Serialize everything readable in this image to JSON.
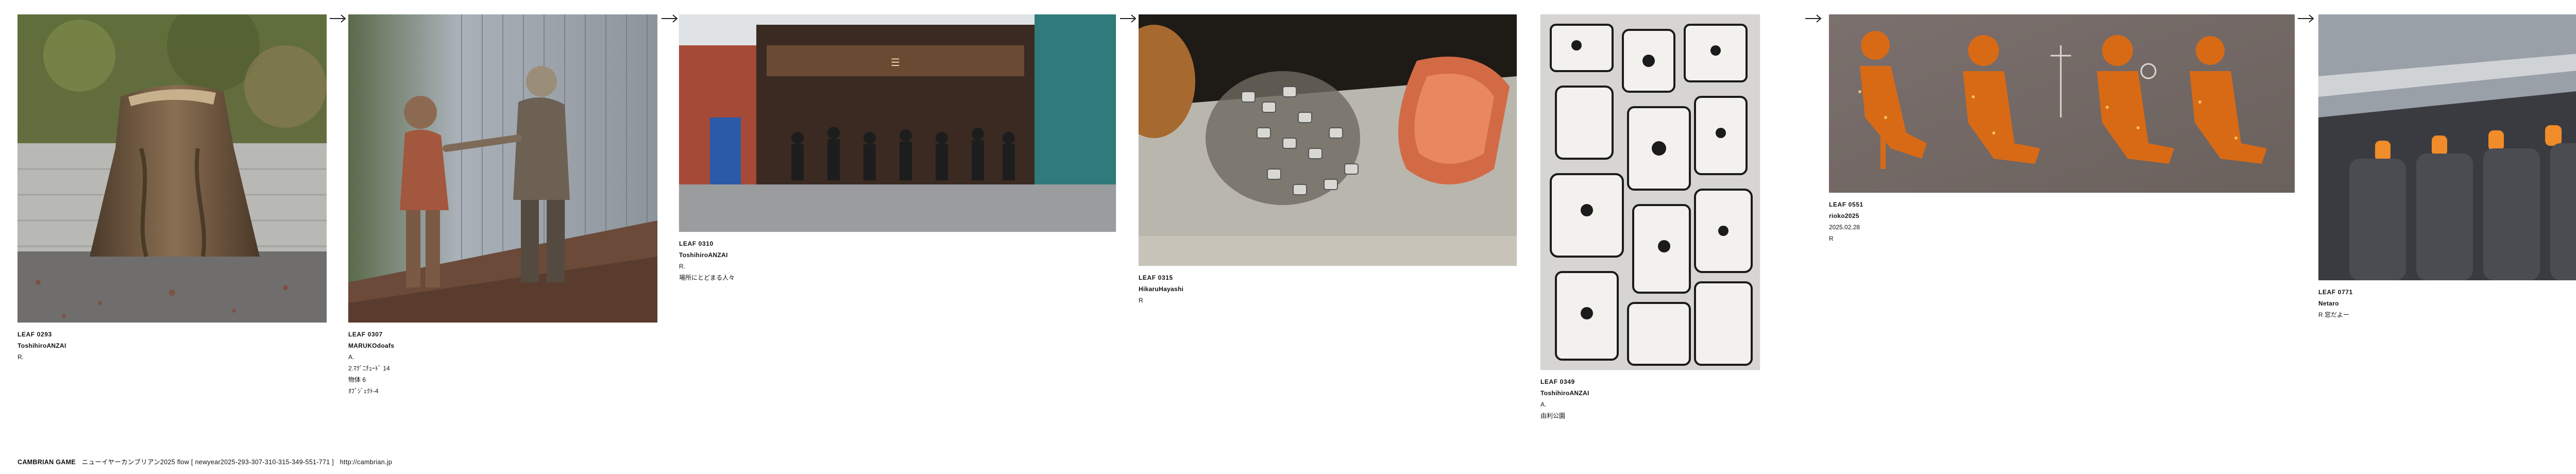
{
  "flow": [
    {
      "id": "LEAF 0293",
      "author": "ToshihiroANZAI",
      "lines": [
        "R."
      ],
      "photo_subject": "tree-stump-in-wall"
    },
    {
      "id": "LEAF 0307",
      "author": "MARUKOdoafs",
      "lines": [
        "A.",
        "2.ﾏｸﾞﾆﾁｭｰﾄﾞ 14",
        "物体 6",
        "ｵﾌﾞｼﾞｪｸﾄ-4"
      ],
      "photo_subject": "statues-handshake"
    },
    {
      "id": "LEAF 0310",
      "author": "ToshihiroANZAI",
      "lines": [
        "R.",
        "場所にとどまる人々"
      ],
      "photo_subject": "shop-front-crowd"
    },
    {
      "id": "LEAF 0315",
      "author": "HikaruHayashi",
      "lines": [
        "R"
      ],
      "photo_subject": "scrap-metal-pile"
    },
    {
      "id": "LEAF 0349",
      "author": "ToshihiroANZAI",
      "lines": [
        "A.",
        "由利公園"
      ],
      "photo_subject": "cubist-relief"
    },
    {
      "id": "LEAF 0551",
      "author": "rioko2025",
      "lines": [
        "2025.02.28",
        "R"
      ],
      "photo_subject": "priority-seat-pictograms"
    },
    {
      "id": "LEAF 0771",
      "author": "Netaro",
      "lines": [
        "R   窓だよー"
      ],
      "photo_subject": "airplane-cabin"
    }
  ],
  "arrow_glyph": "→",
  "footer": {
    "brand": "CAMBRIAN GAME",
    "title": "ニューイヤーカンブリアン2025  flow [ newyear2025-293-307-310-315-349-551-771 ]",
    "url": "http://cambrian.jp"
  },
  "colors": {
    "text": "#111111",
    "arrow": "#222222",
    "background": "#ffffff"
  }
}
